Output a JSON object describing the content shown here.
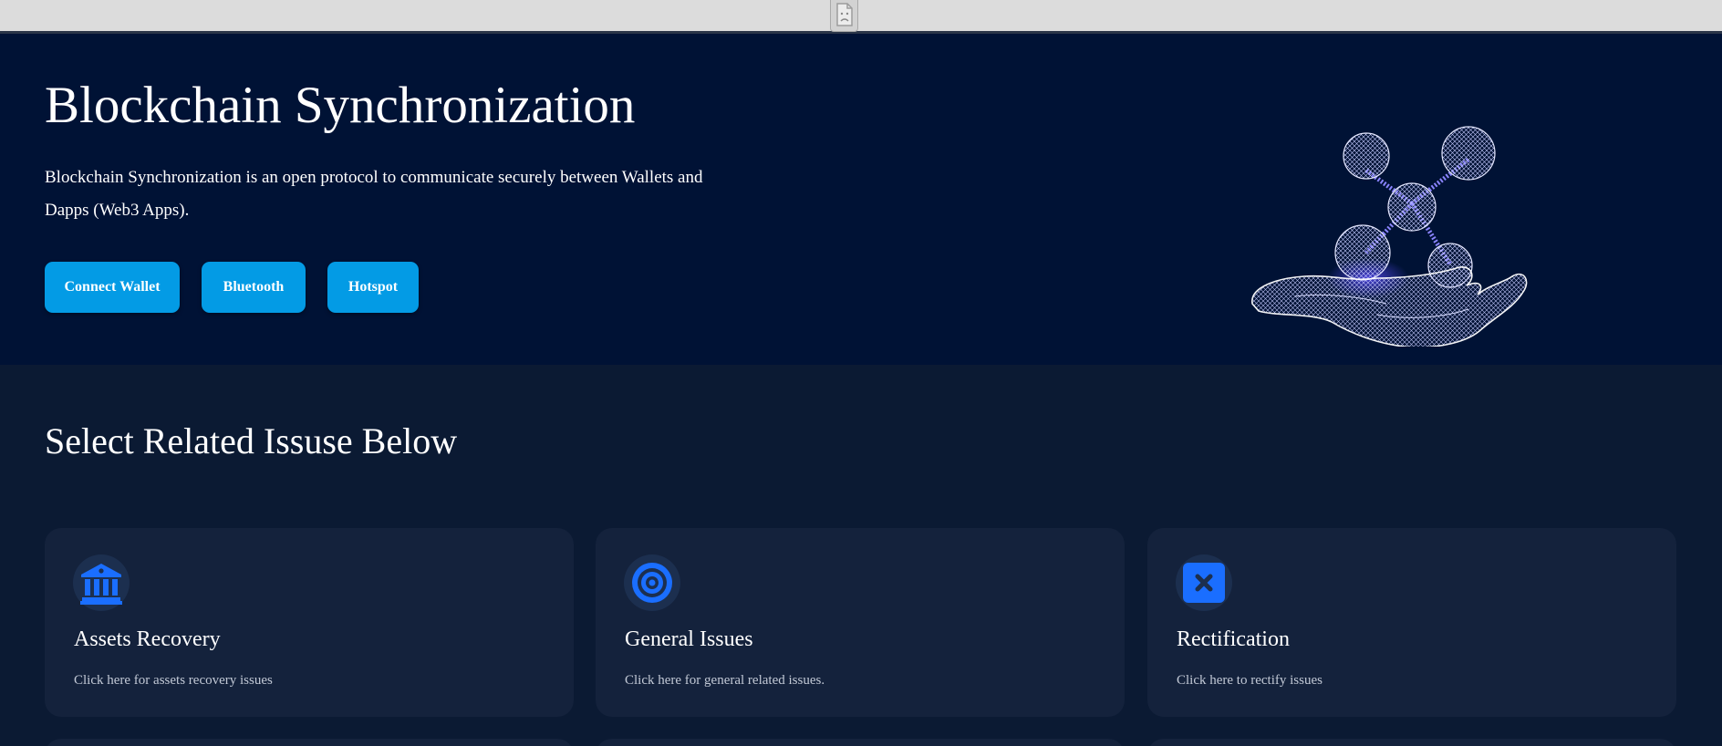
{
  "hero": {
    "title": "Blockchain Synchronization",
    "description": "Blockchain Synchronization is an open protocol to communicate securely between Wallets and Dapps (Web3 Apps).",
    "buttons": {
      "connect_wallet": "Connect Wallet",
      "bluetooth": "Bluetooth",
      "hotspot": "Hotspot"
    },
    "illustration_icon": "wireframe-hand-molecule-icon"
  },
  "issues": {
    "title": "Select Related Issuse Below",
    "cards": [
      {
        "title": "Assets Recovery",
        "description": "Click here for assets recovery issues",
        "icon": "bank-icon"
      },
      {
        "title": "General Issues",
        "description": "Click here for general related issues.",
        "icon": "target-icon"
      },
      {
        "title": "Rectification",
        "description": "Click here to rectify issues",
        "icon": "close-box-icon"
      }
    ]
  },
  "broken_image_icon": "broken-image-icon",
  "colors": {
    "hero_background": "#001235",
    "page_background": "#0b1a33",
    "card_background": "#14223c",
    "button_color": "#039be5",
    "icon_blue": "#1a6eff"
  }
}
